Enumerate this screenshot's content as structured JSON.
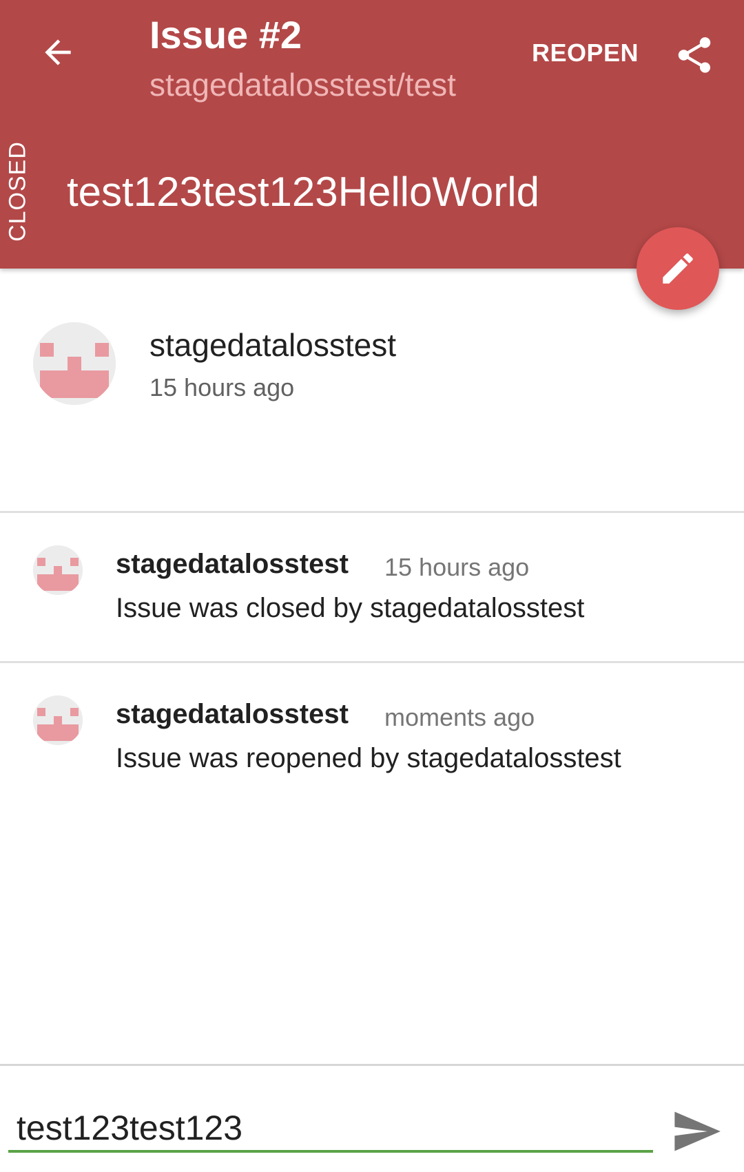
{
  "colors": {
    "header_bg": "#b34848",
    "fab_bg": "#e05757",
    "input_underline": "#5aa347",
    "avatar_pixel": "#e89aa0"
  },
  "toolbar": {
    "back_icon": "arrow-left-icon",
    "title": "Issue #2",
    "subtitle": "stagedatalosstest/test",
    "reopen_label": "REOPEN",
    "share_icon": "share-icon"
  },
  "issue": {
    "state": "CLOSED",
    "title": "test123test123HelloWorld",
    "edit_icon": "pencil-icon"
  },
  "author": {
    "name": "stagedatalosstest",
    "time": "15 hours ago"
  },
  "events": [
    {
      "user": "stagedatalosstest",
      "time": "15 hours ago",
      "text": "Issue was closed by stagedatalosstest"
    },
    {
      "user": "stagedatalosstest",
      "time": "moments ago",
      "text": "Issue was reopened by stagedatalosstest"
    }
  ],
  "comment": {
    "value": "test123test123",
    "send_icon": "send-icon"
  }
}
